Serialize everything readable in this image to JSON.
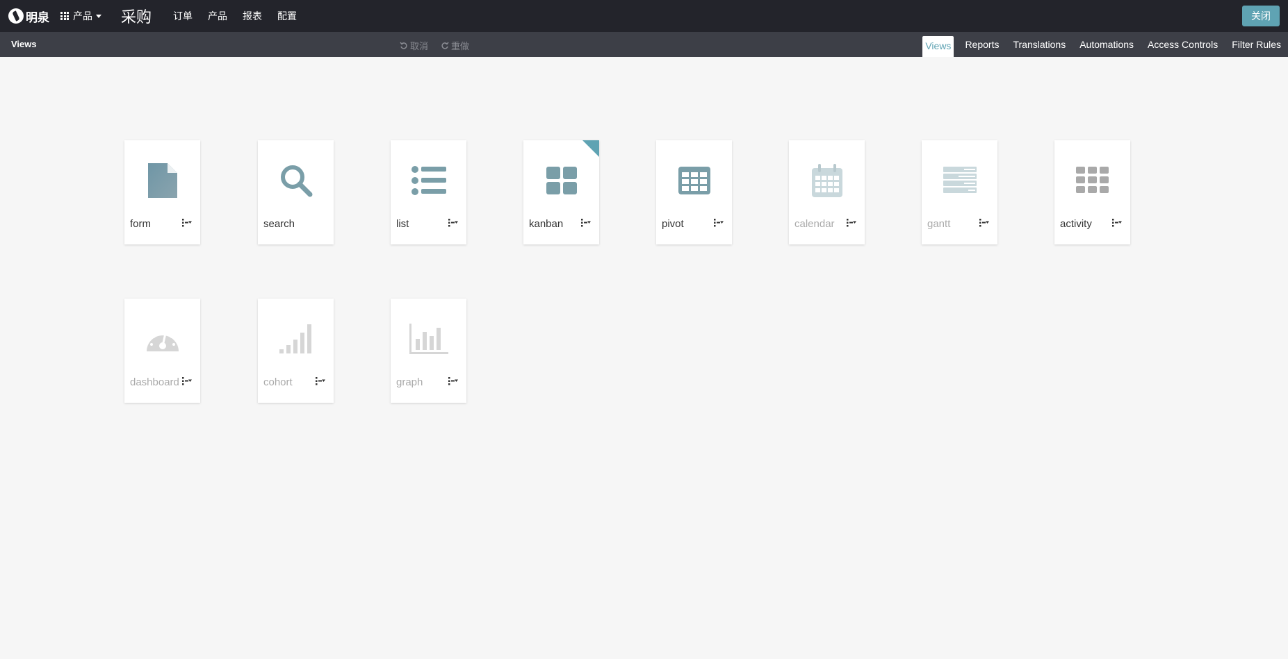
{
  "topbar": {
    "brand": "明泉",
    "apps_menu_label": "产品",
    "app_title": "采购",
    "menu": [
      "订单",
      "产品",
      "报表",
      "配置"
    ],
    "close_label": "关闭"
  },
  "subbar": {
    "title": "Views",
    "undo_label": "取消",
    "redo_label": "重做",
    "tabs": [
      "Views",
      "Reports",
      "Translations",
      "Automations",
      "Access Controls",
      "Filter Rules"
    ],
    "active_tab": "Views"
  },
  "views": [
    {
      "label": "form",
      "active": true,
      "icon": "file-icon"
    },
    {
      "label": "search",
      "active": true,
      "icon": "search-icon"
    },
    {
      "label": "list",
      "active": true,
      "icon": "list-icon"
    },
    {
      "label": "kanban",
      "active": true,
      "default": true,
      "icon": "kanban-icon"
    },
    {
      "label": "pivot",
      "active": true,
      "icon": "table-icon"
    },
    {
      "label": "calendar",
      "active": false,
      "icon": "calendar-icon"
    },
    {
      "label": "gantt",
      "active": false,
      "icon": "gantt-icon"
    },
    {
      "label": "activity",
      "active": true,
      "icon": "activity-grid-icon"
    },
    {
      "label": "dashboard",
      "active": false,
      "icon": "gauge-icon"
    },
    {
      "label": "cohort",
      "active": false,
      "icon": "signal-bars-icon"
    },
    {
      "label": "graph",
      "active": false,
      "icon": "bar-chart-icon"
    }
  ],
  "colors": {
    "topbar_bg": "#23242b",
    "subbar_bg": "#3d3f47",
    "accent": "#5fa3b3",
    "icon_active": "#7a9ea8",
    "icon_inactive": "#c9d8dc"
  }
}
